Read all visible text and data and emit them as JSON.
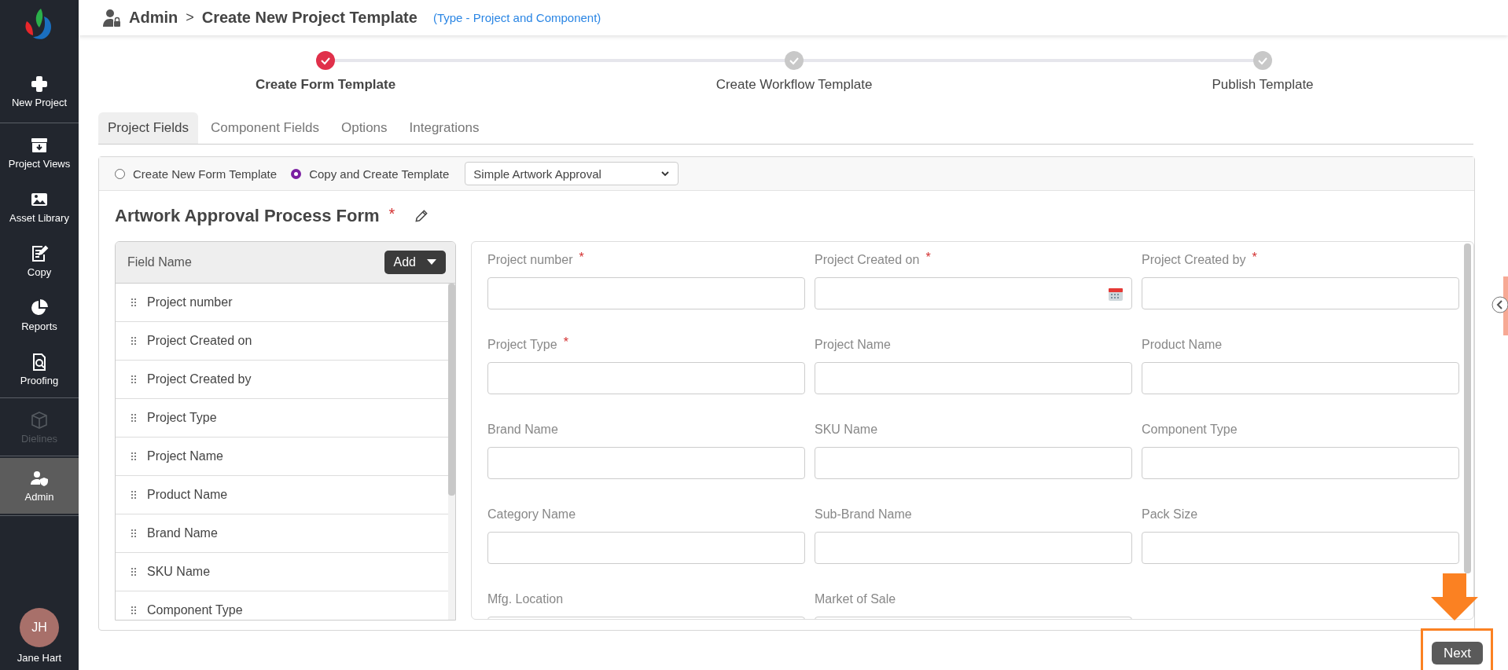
{
  "sidebar": {
    "sections": [
      [
        {
          "label": "New Project",
          "selected": false,
          "disabled": false
        }
      ],
      [
        {
          "label": "Project Views",
          "selected": false,
          "disabled": false
        },
        {
          "label": "Asset Library",
          "selected": false,
          "disabled": false
        },
        {
          "label": "Copy",
          "selected": false,
          "disabled": false
        },
        {
          "label": "Reports",
          "selected": false,
          "disabled": false
        },
        {
          "label": "Proofing",
          "selected": false,
          "disabled": false
        }
      ],
      [
        {
          "label": "Dielines",
          "selected": false,
          "disabled": true
        }
      ],
      [
        {
          "label": "Admin",
          "selected": true,
          "disabled": false
        }
      ]
    ],
    "user": {
      "initials": "JH",
      "name": "Jane Hart"
    }
  },
  "breadcrumb": {
    "parent": "Admin",
    "separator": ">",
    "current": "Create New Project Template",
    "type_note": "(Type - Project and Component)"
  },
  "steps": [
    {
      "label": "Create Form Template",
      "selected": true
    },
    {
      "label": "Create Workflow Template",
      "selected": false
    },
    {
      "label": "Publish Template",
      "selected": false
    }
  ],
  "tabs": [
    {
      "label": "Project Fields",
      "selected": true
    },
    {
      "label": "Component Fields",
      "selected": false
    },
    {
      "label": "Options",
      "selected": false
    },
    {
      "label": "Integrations",
      "selected": false
    }
  ],
  "template_source": {
    "options": [
      {
        "label": "Create New Form Template",
        "selected": false
      },
      {
        "label": "Copy and Create Template",
        "selected": true
      }
    ],
    "template_select": "Simple Artwork Approval"
  },
  "form_title": {
    "text": "Artwork Approval Process Form",
    "required_mark": "*"
  },
  "field_list": {
    "header": "Field Name",
    "add_button": "Add",
    "items": [
      "Project number",
      "Project Created on",
      "Project Created by",
      "Project Type",
      "Project Name",
      "Product Name",
      "Brand Name",
      "SKU Name",
      "Component Type"
    ]
  },
  "form_fields": [
    {
      "label": "Project number",
      "required_mark": "*",
      "kind": "text"
    },
    {
      "label": "Project Created on",
      "required_mark": "*",
      "kind": "date"
    },
    {
      "label": "Project Created by",
      "required_mark": "*",
      "kind": "text"
    },
    {
      "label": "Project Type",
      "required_mark": "*",
      "kind": "text"
    },
    {
      "label": "Project Name",
      "kind": "text"
    },
    {
      "label": "Product Name",
      "kind": "text"
    },
    {
      "label": "Brand Name",
      "kind": "text"
    },
    {
      "label": "SKU Name",
      "kind": "text"
    },
    {
      "label": "Component Type",
      "kind": "text"
    },
    {
      "label": "Category Name",
      "kind": "text"
    },
    {
      "label": "Sub-Brand Name",
      "kind": "text"
    },
    {
      "label": "Pack Size",
      "kind": "text"
    },
    {
      "label": "Mfg. Location",
      "kind": "text"
    },
    {
      "label": "Market of Sale",
      "kind": "text"
    }
  ],
  "next_button": "Next"
}
